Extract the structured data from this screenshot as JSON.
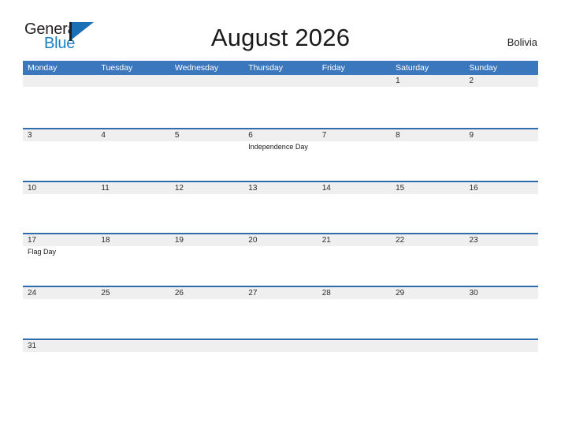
{
  "branding": {
    "logo_text_primary": "General",
    "logo_text_secondary": "Blue",
    "logo_mark_icon": "triangle-flag-icon"
  },
  "header": {
    "title": "August 2026",
    "country": "Bolivia"
  },
  "colors": {
    "header_blue": "#3b77bd",
    "row_border_blue": "#2e6cad",
    "date_band_gray": "#efefef",
    "logo_blue": "#1a7fc1",
    "logo_dark": "#231f20",
    "text_dark": "#1a1a1a"
  },
  "calendar": {
    "month": "August",
    "year": "2026",
    "weekdays": [
      "Monday",
      "Tuesday",
      "Wednesday",
      "Thursday",
      "Friday",
      "Saturday",
      "Sunday"
    ],
    "weeks": [
      [
        {
          "day": "",
          "events": []
        },
        {
          "day": "",
          "events": []
        },
        {
          "day": "",
          "events": []
        },
        {
          "day": "",
          "events": []
        },
        {
          "day": "",
          "events": []
        },
        {
          "day": "1",
          "events": []
        },
        {
          "day": "2",
          "events": []
        }
      ],
      [
        {
          "day": "3",
          "events": []
        },
        {
          "day": "4",
          "events": []
        },
        {
          "day": "5",
          "events": []
        },
        {
          "day": "6",
          "events": [
            "Independence Day"
          ]
        },
        {
          "day": "7",
          "events": []
        },
        {
          "day": "8",
          "events": []
        },
        {
          "day": "9",
          "events": []
        }
      ],
      [
        {
          "day": "10",
          "events": []
        },
        {
          "day": "11",
          "events": []
        },
        {
          "day": "12",
          "events": []
        },
        {
          "day": "13",
          "events": []
        },
        {
          "day": "14",
          "events": []
        },
        {
          "day": "15",
          "events": []
        },
        {
          "day": "16",
          "events": []
        }
      ],
      [
        {
          "day": "17",
          "events": [
            "Flag Day"
          ]
        },
        {
          "day": "18",
          "events": []
        },
        {
          "day": "19",
          "events": []
        },
        {
          "day": "20",
          "events": []
        },
        {
          "day": "21",
          "events": []
        },
        {
          "day": "22",
          "events": []
        },
        {
          "day": "23",
          "events": []
        }
      ],
      [
        {
          "day": "24",
          "events": []
        },
        {
          "day": "25",
          "events": []
        },
        {
          "day": "26",
          "events": []
        },
        {
          "day": "27",
          "events": []
        },
        {
          "day": "28",
          "events": []
        },
        {
          "day": "29",
          "events": []
        },
        {
          "day": "30",
          "events": []
        }
      ],
      [
        {
          "day": "31",
          "events": []
        },
        {
          "day": "",
          "events": []
        },
        {
          "day": "",
          "events": []
        },
        {
          "day": "",
          "events": []
        },
        {
          "day": "",
          "events": []
        },
        {
          "day": "",
          "events": []
        },
        {
          "day": "",
          "events": []
        }
      ]
    ]
  }
}
